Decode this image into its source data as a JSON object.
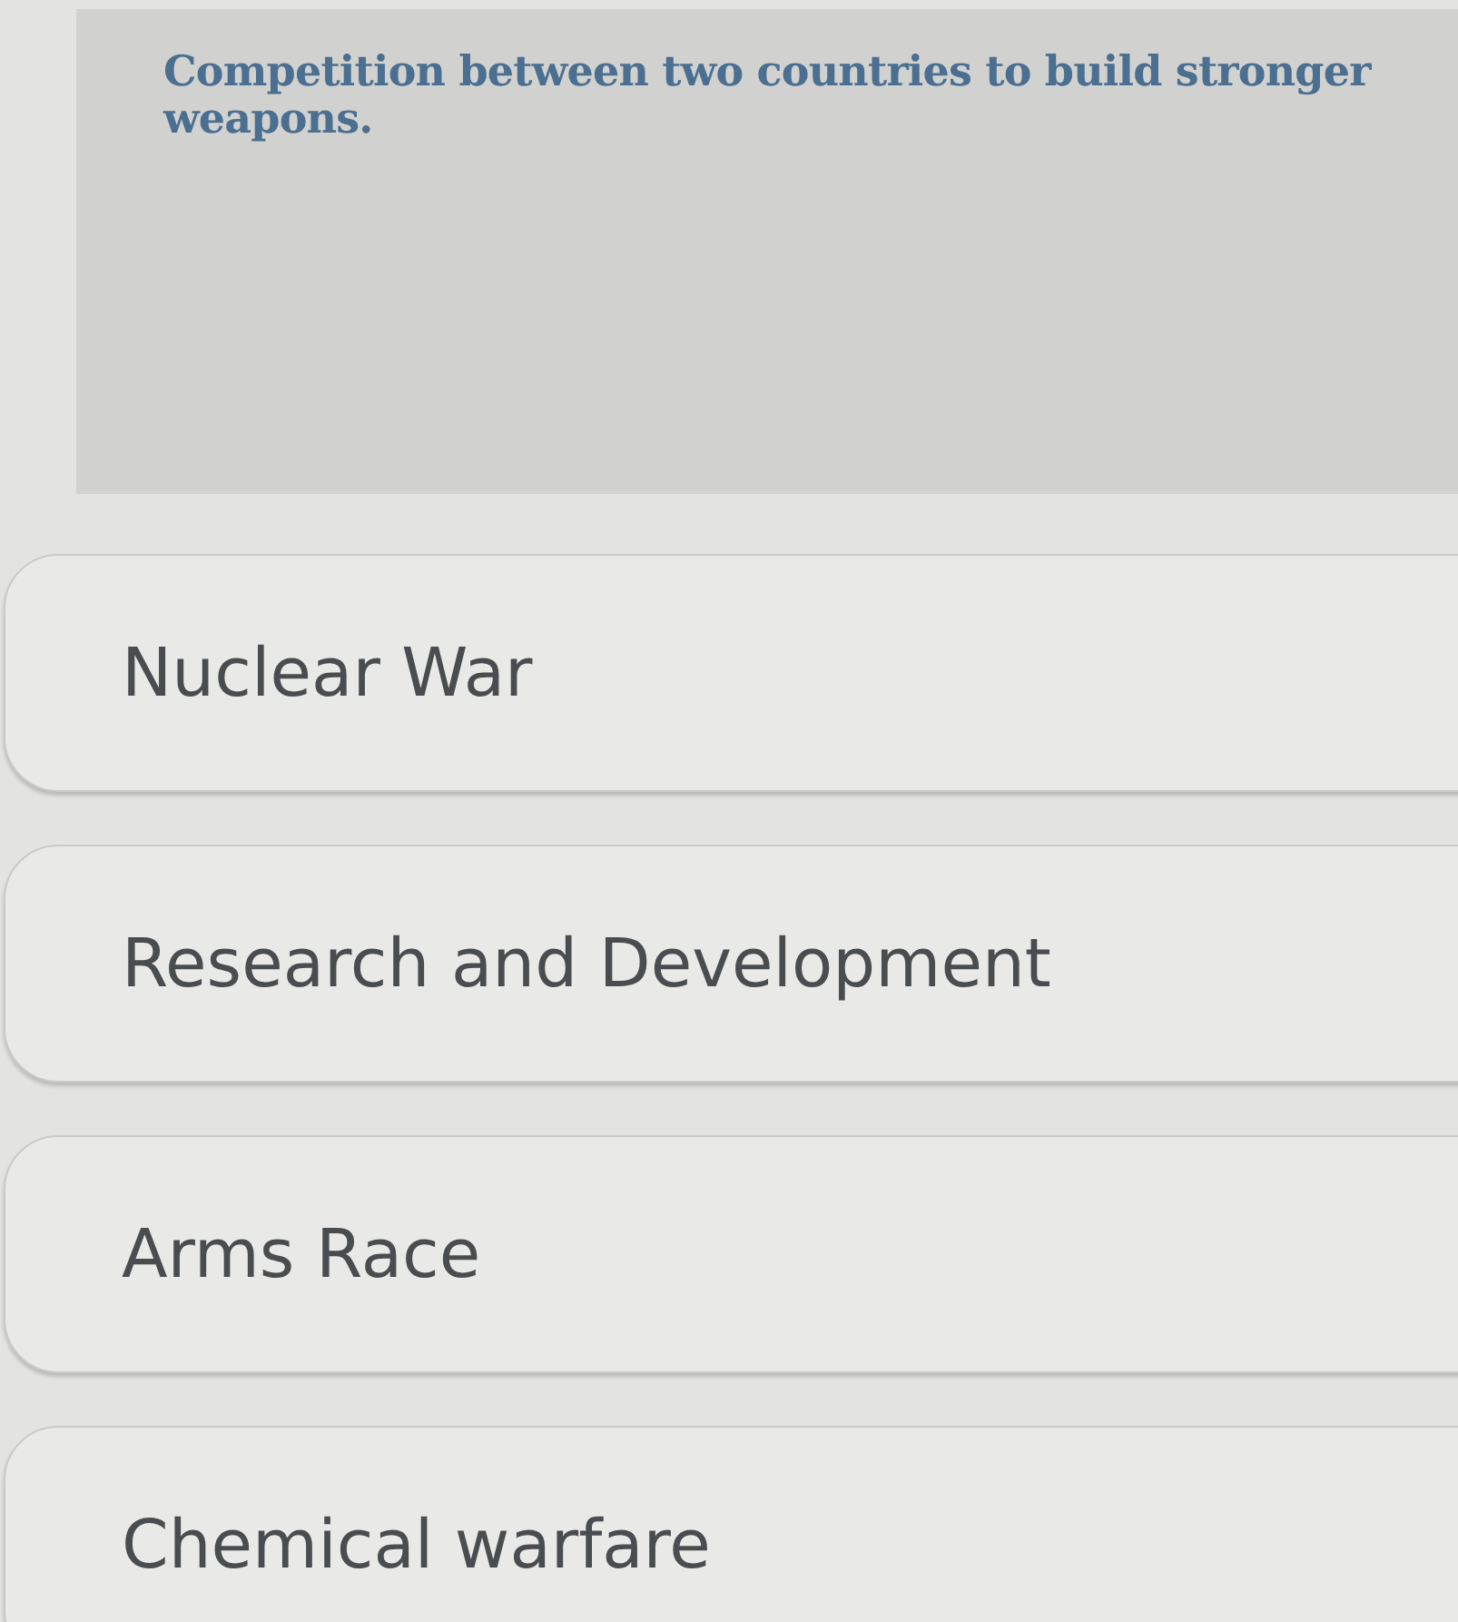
{
  "question": {
    "text": "Competition between two countries to build stronger weapons."
  },
  "options": [
    {
      "label": "Nuclear War",
      "selected": false
    },
    {
      "label": "Research and Development",
      "selected": false
    },
    {
      "label": "Arms Race",
      "selected": false
    },
    {
      "label": "Chemical warfare",
      "selected": false
    }
  ]
}
